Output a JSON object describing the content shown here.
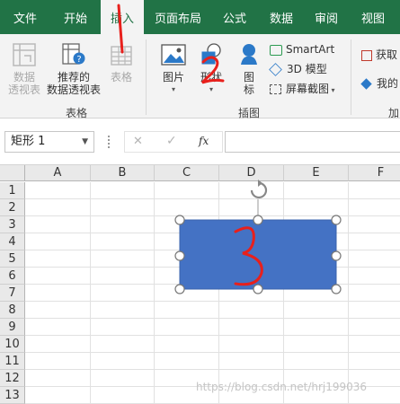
{
  "tabs": [
    "文件",
    "开始",
    "插入",
    "页面布局",
    "公式",
    "数据",
    "审阅",
    "视图"
  ],
  "active_tab": "插入",
  "ribbon": {
    "pivot_table": "数据\n透视表",
    "recommended_pivot_line1": "推荐的",
    "recommended_pivot_line2": "数据透视表",
    "table_btn": "表格",
    "group_tables": "表格",
    "pictures": "图片",
    "shapes": "形状",
    "icons": "图\n标",
    "smartart": "SmartArt",
    "model3d": "3D 模型",
    "screenshot": "屏幕截图",
    "group_illustrations": "插图",
    "get_addins": "获取",
    "my_addins": "我的",
    "group_addins": "加"
  },
  "formula_bar": {
    "name_box": "矩形 1",
    "cancel": "✕",
    "confirm": "✓",
    "fx": "fx"
  },
  "columns": [
    "A",
    "B",
    "C",
    "D",
    "E",
    "F"
  ],
  "rows": [
    "1",
    "2",
    "3",
    "4",
    "5",
    "6",
    "7",
    "8",
    "9",
    "10",
    "11",
    "12",
    "13"
  ],
  "shape": {
    "fill": "#4472c4",
    "annotation": "3"
  },
  "annotations": {
    "tab_mark": "1",
    "shapes_mark": "2"
  },
  "watermark": "https://blog.csdn.net/hrj199036",
  "colors": {
    "accent": "#217346",
    "shape_fill": "#4472c4",
    "handwriting": "#e8201c"
  }
}
